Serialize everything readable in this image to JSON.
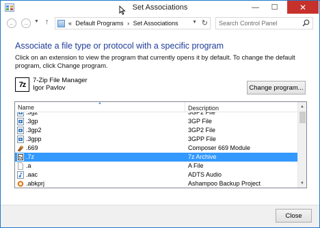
{
  "window": {
    "title": "Set Associations",
    "minimize_glyph": "—",
    "maximize_glyph": "☐",
    "close_glyph": "✕"
  },
  "nav": {
    "back_icon": "back-arrow-icon",
    "forward_icon": "forward-arrow-icon",
    "up_icon": "up-arrow-icon",
    "breadcrumb_prefix": "«",
    "breadcrumb": [
      "Default Programs",
      "Set Associations"
    ],
    "breadcrumb_separator": "›",
    "search_placeholder": "Search Control Panel"
  },
  "content": {
    "heading": "Associate a file type or protocol with a specific program",
    "description": "Click on an extension to view the program that currently opens it by default. To change the default program, click Change program.",
    "program": {
      "icon_text": "7z",
      "name": "7-Zip File Manager",
      "author": "Igor Pavlov"
    },
    "change_program_label": "Change program..."
  },
  "list": {
    "columns": [
      "Name",
      "Description"
    ],
    "rows": [
      {
        "ext": ".3g2",
        "description": "3GP2 File",
        "icon": "video-file-icon",
        "partial": true
      },
      {
        "ext": ".3gp",
        "description": "3GP File",
        "icon": "video-file-icon"
      },
      {
        "ext": ".3gp2",
        "description": "3GP2 File",
        "icon": "video-file-icon"
      },
      {
        "ext": ".3gpp",
        "description": "3GPP File",
        "icon": "video-file-icon"
      },
      {
        "ext": ".669",
        "description": "Composer 669 Module",
        "icon": "media-module-icon"
      },
      {
        "ext": ".7z",
        "description": "7z Archive",
        "icon": "archive-icon",
        "selected": true
      },
      {
        "ext": ".a",
        "description": "A File",
        "icon": "generic-file-icon"
      },
      {
        "ext": ".aac",
        "description": "ADTS Audio",
        "icon": "audio-file-icon"
      },
      {
        "ext": ".abkprj",
        "description": "Ashampoo Backup Project",
        "icon": "backup-project-icon",
        "partial": true
      }
    ]
  },
  "footer": {
    "close_label": "Close"
  },
  "colors": {
    "heading": "#1e3c9a",
    "selection": "#3399ff",
    "close_button": "#c7312b",
    "window_border": "#1f78c8"
  }
}
